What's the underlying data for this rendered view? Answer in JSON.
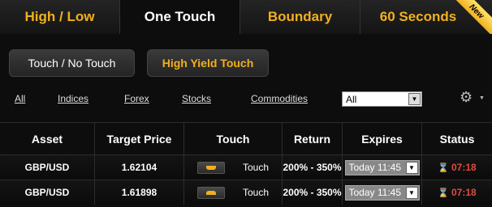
{
  "tabs": [
    {
      "label": "High / Low",
      "active": false
    },
    {
      "label": "One Touch",
      "active": true
    },
    {
      "label": "Boundary",
      "active": false
    },
    {
      "label": "60 Seconds",
      "active": false,
      "badge": "New"
    }
  ],
  "subtypes": {
    "touch_no_touch": "Touch / No Touch",
    "high_yield_touch": "High Yield Touch"
  },
  "filters": {
    "all": "All",
    "indices": "Indices",
    "forex": "Forex",
    "stocks": "Stocks",
    "commodities": "Commodities",
    "select_value": "All",
    "settings_icon": "gear-icon"
  },
  "table": {
    "headers": {
      "asset": "Asset",
      "target_price": "Target Price",
      "touch": "Touch",
      "return": "Return",
      "expires": "Expires",
      "status": "Status"
    },
    "rows": [
      {
        "asset": "GBP/USD",
        "target_price": "1.62104",
        "touch": "Touch",
        "direction": "up",
        "return": "200% - 350%",
        "expires": "Today 11:45",
        "status": "07:18"
      },
      {
        "asset": "GBP/USD",
        "target_price": "1.61898",
        "touch": "Touch",
        "direction": "down",
        "return": "200% - 350%",
        "expires": "Today 11:45",
        "status": "07:18"
      }
    ]
  },
  "colors": {
    "accent": "#f2b01e",
    "status": "#e24a3b"
  }
}
